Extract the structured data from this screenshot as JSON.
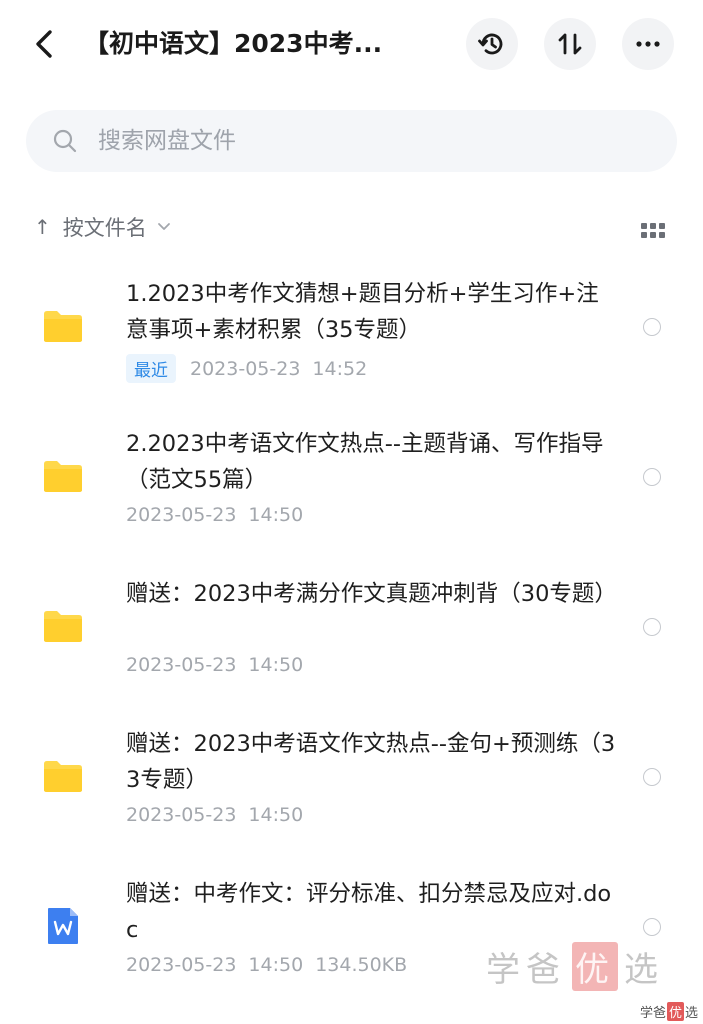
{
  "header": {
    "title": "【初中语文】2023中考...",
    "back_icon": "chevron-left-icon",
    "history_icon": "history-icon",
    "sort_icon": "sort-arrows-icon",
    "more_icon": "more-horizontal-icon"
  },
  "search": {
    "placeholder": "搜索网盘文件"
  },
  "sort_bar": {
    "label": "按文件名",
    "arrow": "↑"
  },
  "files": [
    {
      "type": "folder",
      "name": "1.2023中考作文猜想+题目分析+学生习作+注意事项+素材积累（35专题）",
      "badge": "最近",
      "date": "2023-05-23",
      "time": "14:52",
      "size": ""
    },
    {
      "type": "folder",
      "name": "2.2023中考语文作文热点--主题背诵、写作指导（范文55篇）",
      "badge": "",
      "date": "2023-05-23",
      "time": "14:50",
      "size": ""
    },
    {
      "type": "folder",
      "name": "赠送：2023中考满分作文真题冲刺背（30专题）",
      "badge": "",
      "date": "2023-05-23",
      "time": "14:50",
      "size": ""
    },
    {
      "type": "folder",
      "name": "赠送：2023中考语文作文热点--金句+预测练（33专题）",
      "badge": "",
      "date": "2023-05-23",
      "time": "14:50",
      "size": ""
    },
    {
      "type": "doc",
      "name": "赠送：中考作文：评分标准、扣分禁忌及应对.doc",
      "badge": "",
      "date": "2023-05-23",
      "time": "14:50",
      "size": "134.50KB"
    }
  ],
  "watermark": {
    "part1": "学爸",
    "highlight": "优",
    "part2": "选"
  },
  "colors": {
    "folder": "#FFD84A",
    "doc": "#3D7FF0",
    "badge_text": "#2F8AE6",
    "badge_bg": "#EAF4FD"
  }
}
